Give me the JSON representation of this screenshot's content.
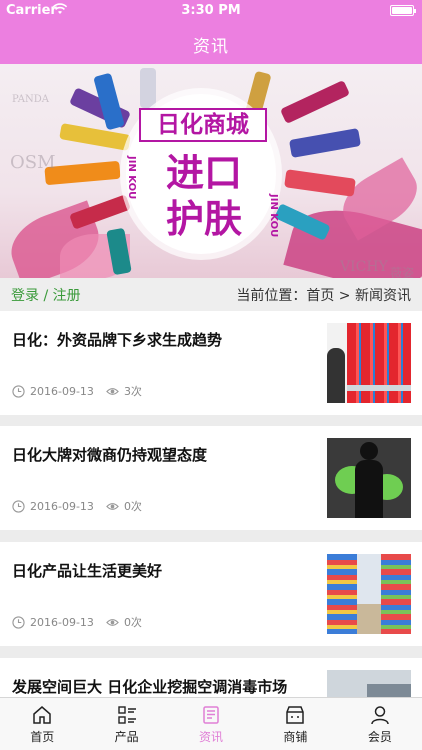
{
  "status_bar": {
    "carrier": "Carrier",
    "time": "3:30 PM",
    "battery_level": 1.0
  },
  "header": {
    "title": "资讯"
  },
  "banner": {
    "title_line1": "日化商城",
    "title_line2": "进口护肤",
    "side_text": "JIN KOU",
    "watermarks": [
      "OSM",
      "VICHY",
      "PANDA",
      "薇姿"
    ]
  },
  "location_bar": {
    "login_label": "登录 / 注册",
    "breadcrumb": "当前位置：首页 > 新闻资讯"
  },
  "news": [
    {
      "title": "日化：外资品牌下乡求生成趋势",
      "date": "2016-09-13",
      "views": "3次",
      "thumb_icon": "shampoo-shelf-image"
    },
    {
      "title": "日化大牌对微商仍持观望态度",
      "date": "2016-09-13",
      "views": "0次",
      "thumb_icon": "wechat-silhouette-image"
    },
    {
      "title": "日化产品让生活更美好",
      "date": "2016-09-13",
      "views": "0次",
      "thumb_icon": "supermarket-aisle-image"
    },
    {
      "title": "发展空间巨大 日化企业挖掘空调消毒市场",
      "date": "",
      "views": "",
      "thumb_icon": "store-image"
    }
  ],
  "tabbar": {
    "tabs": [
      {
        "label": "首页",
        "icon": "home-icon"
      },
      {
        "label": "产品",
        "icon": "list-icon"
      },
      {
        "label": "资讯",
        "icon": "news-icon"
      },
      {
        "label": "商铺",
        "icon": "shop-icon"
      },
      {
        "label": "会员",
        "icon": "user-icon"
      }
    ],
    "active_index": 2
  },
  "colors": {
    "accent": "#ec7fe0",
    "login_green": "#3a9a3a",
    "banner_magenta": "#b316a3"
  }
}
